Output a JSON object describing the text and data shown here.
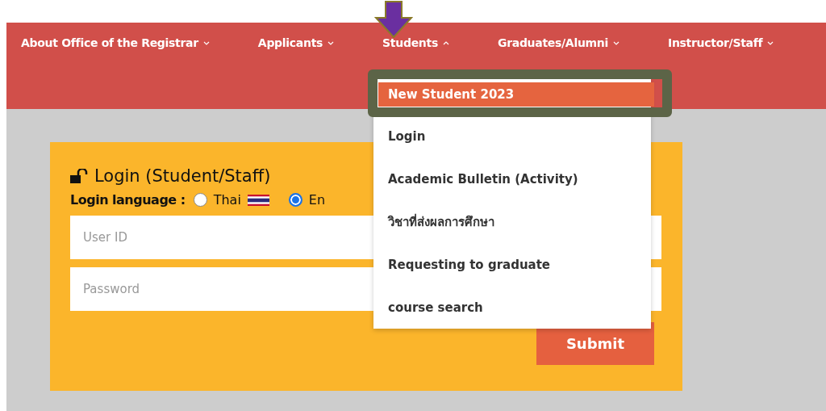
{
  "nav": [
    {
      "label": "About Office of the Registrar",
      "expanded": false
    },
    {
      "label": "Applicants",
      "expanded": false
    },
    {
      "label": "Students",
      "expanded": true
    },
    {
      "label": "Graduates/Alumni",
      "expanded": false
    },
    {
      "label": "Instructor/Staff",
      "expanded": false
    }
  ],
  "dropdown": [
    {
      "label": "New Student 2023",
      "selected": true
    },
    {
      "label": "Login",
      "selected": false
    },
    {
      "label": "Academic Bulletin (Activity)",
      "selected": false
    },
    {
      "label": "วิชาที่ส่งผลการศึกษา",
      "selected": false
    },
    {
      "label": "Requesting to graduate",
      "selected": false
    },
    {
      "label": "course search",
      "selected": false
    }
  ],
  "login": {
    "title": "Login (Student/Staff)",
    "language_label": "Login language :",
    "languages": [
      {
        "label": "Thai",
        "selected": false,
        "flag": true
      },
      {
        "label": "En",
        "selected": true,
        "flag": false
      }
    ],
    "fields": [
      {
        "placeholder": "User ID"
      },
      {
        "placeholder": "Password"
      }
    ],
    "submit": "Submit"
  }
}
